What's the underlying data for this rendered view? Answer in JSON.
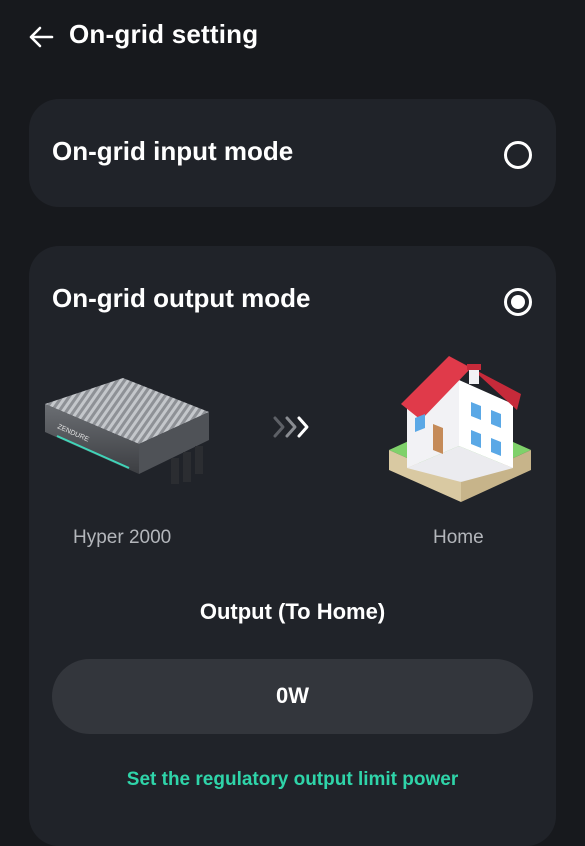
{
  "header": {
    "title": "On-grid setting",
    "back_icon": "arrow-left-icon"
  },
  "input_mode": {
    "label": "On-grid input mode",
    "selected": false
  },
  "output_mode": {
    "label": "On-grid output mode",
    "selected": true,
    "device_name": "Hyper 2000",
    "device_label_text": "ZENDURE",
    "destination_name": "Home",
    "flow_icon": "triple-chevron-right-icon",
    "output_title": "Output (To Home)",
    "output_value": "0W",
    "limit_link": "Set the regulatory output limit power"
  },
  "colors": {
    "background": "#17191d",
    "card": "#202329",
    "field": "#33363c",
    "accent": "#2fd4a9",
    "roof": "#e03a4a"
  }
}
